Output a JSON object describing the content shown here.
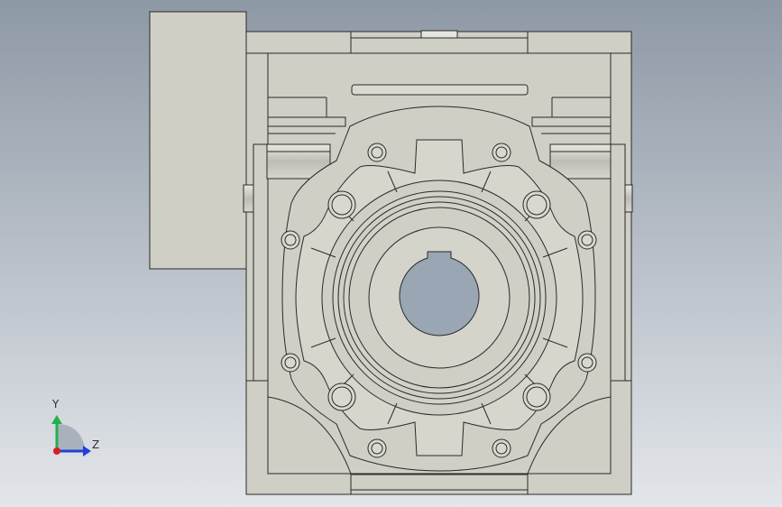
{
  "scene": {
    "model": "worm-gear-reducer",
    "view": "front",
    "background_top": "#8e99a6",
    "background_bottom": "#e3e6ea",
    "part_fill": "#cfcfc6",
    "part_fill_dark": "#b9b9b0",
    "edge_color": "#2a2a2a",
    "bore_fill": "#9aa6b4"
  },
  "triad": {
    "y_label": "Y",
    "z_label": "Z",
    "y_color": "#22b24c",
    "z_color": "#2240d8",
    "x_color": "#d62020"
  }
}
